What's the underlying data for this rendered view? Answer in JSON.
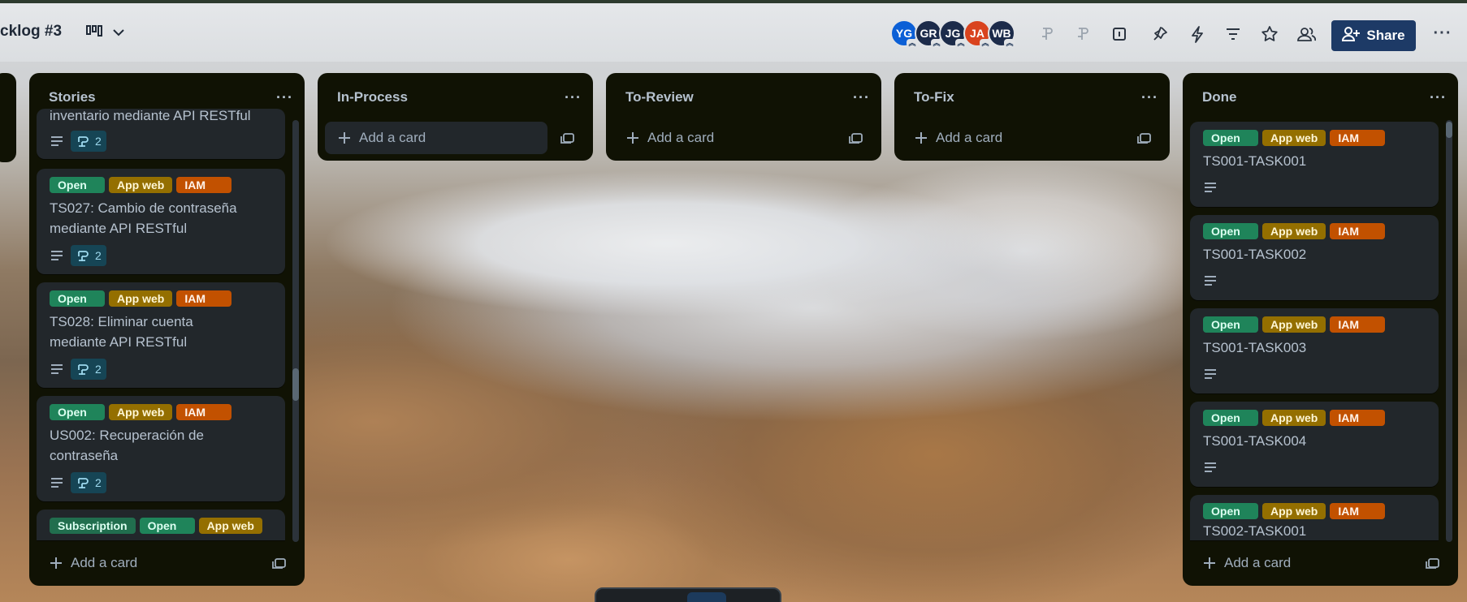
{
  "board": {
    "title": "cklog #3",
    "view_icon": "board-view-icon",
    "view_chevron": "chevron-down-icon"
  },
  "header": {
    "avatars": [
      {
        "initials": "YG",
        "color": "#0b5fd6"
      },
      {
        "initials": "GR",
        "color": "#1c2b4a"
      },
      {
        "initials": "JG",
        "color": "#1c2b4a"
      },
      {
        "initials": "JA",
        "color": "#d9431e"
      },
      {
        "initials": "WB",
        "color": "#1c2b4a"
      }
    ],
    "icons": [
      "power-up-icon",
      "power-up-icon",
      "calendar-icon",
      "pin-icon",
      "automation-icon",
      "filter-icon",
      "star-icon",
      "members-icon"
    ],
    "share_label": "Share",
    "more_label": "···"
  },
  "lists": {
    "stories": {
      "title": "Stories",
      "menu": "···",
      "cards": [
        {
          "title": "inventario mediante API RESTful",
          "checklist": "2"
        },
        {
          "labels": [
            "Open",
            "App web",
            "IAM"
          ],
          "title": "TS027: Cambio de contraseña mediante API RESTful",
          "checklist": "2"
        },
        {
          "labels": [
            "Open",
            "App web",
            "IAM"
          ],
          "title": "TS028: Eliminar cuenta mediante API RESTful",
          "checklist": "2"
        },
        {
          "labels": [
            "Open",
            "App web",
            "IAM"
          ],
          "title": "US002: Recuperación de contraseña",
          "checklist": "2"
        },
        {
          "labels": [
            "Subscription",
            "Open",
            "App web"
          ]
        }
      ],
      "add_card": "Add a card"
    },
    "in_process": {
      "title": "In-Process",
      "menu": "···",
      "add_card": "Add a card"
    },
    "to_review": {
      "title": "To-Review",
      "menu": "···",
      "add_card": "Add a card"
    },
    "to_fix": {
      "title": "To-Fix",
      "menu": "···",
      "add_card": "Add a card"
    },
    "done": {
      "title": "Done",
      "menu": "···",
      "cards": [
        {
          "labels": [
            "Open",
            "App web",
            "IAM"
          ],
          "title": "TS001-TASK001"
        },
        {
          "labels": [
            "Open",
            "App web",
            "IAM"
          ],
          "title": "TS001-TASK002"
        },
        {
          "labels": [
            "Open",
            "App web",
            "IAM"
          ],
          "title": "TS001-TASK003"
        },
        {
          "labels": [
            "Open",
            "App web",
            "IAM"
          ],
          "title": "TS001-TASK004"
        },
        {
          "labels": [
            "Open",
            "App web",
            "IAM"
          ],
          "title": "TS002-TASK001"
        }
      ],
      "add_card": "Add a card"
    }
  },
  "colors": {
    "list_bg": "#101204",
    "card_bg": "#22272b",
    "label_open": "#1f845a",
    "label_app_web": "#946f00",
    "label_iam": "#c25100",
    "share_button": "#1d3a66"
  }
}
